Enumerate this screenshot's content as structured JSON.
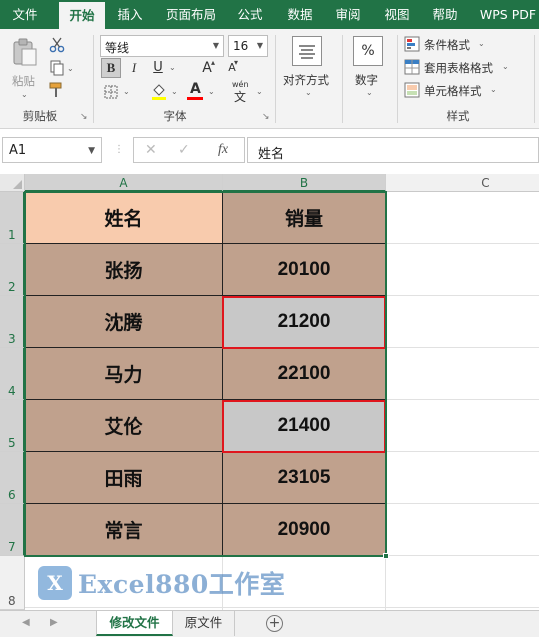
{
  "colors": {
    "brand": "#217346",
    "header_fill": "#f8cbad",
    "data_fill": "#c0a18d",
    "highlight_fill": "#c8c8c8",
    "highlight_border": "#e0161d"
  },
  "menu": {
    "tabs": [
      "文件",
      "开始",
      "插入",
      "页面布局",
      "公式",
      "数据",
      "审阅",
      "视图",
      "帮助",
      "WPS PDF"
    ],
    "active": "开始"
  },
  "ribbon": {
    "clipboard": {
      "paste_label": "粘贴",
      "group_label": "剪贴板",
      "icons": [
        "paste-icon",
        "cut-icon",
        "copy-icon",
        "format-painter-icon"
      ]
    },
    "font": {
      "font_name": "等线",
      "font_size": "16",
      "group_label": "字体",
      "bold": "B",
      "italic": "I",
      "underline": "U",
      "grow": "A",
      "shrink": "A",
      "font_color_letter": "A",
      "phonetic": "wén",
      "phonetic_char": "文"
    },
    "alignment": {
      "label": "对齐方式"
    },
    "number": {
      "label": "数字",
      "symbol": "%"
    },
    "styles": {
      "items": [
        "条件格式",
        "套用表格格式",
        "单元格样式"
      ],
      "group_label": "样式"
    }
  },
  "formula_bar": {
    "cell_ref": "A1",
    "fx_label": "fx",
    "content": "姓名"
  },
  "sheet": {
    "columns": [
      "A",
      "B",
      "C"
    ],
    "rows": [
      "1",
      "2",
      "3",
      "4",
      "5",
      "6",
      "7",
      "8"
    ],
    "table": {
      "headers": [
        "姓名",
        "销量"
      ],
      "records": [
        [
          "张扬",
          "20100"
        ],
        [
          "沈腾",
          "21200"
        ],
        [
          "马力",
          "22100"
        ],
        [
          "艾伦",
          "21400"
        ],
        [
          "田雨",
          "23105"
        ],
        [
          "常言",
          "20900"
        ]
      ],
      "highlighted_values": [
        "21200",
        "21400"
      ]
    },
    "selection": "A1:B7"
  },
  "watermark": {
    "logo_text": "X",
    "text": "Excel880工作室"
  },
  "sheet_tabs": {
    "tabs": [
      "修改文件",
      "原文件"
    ],
    "active": "修改文件"
  }
}
